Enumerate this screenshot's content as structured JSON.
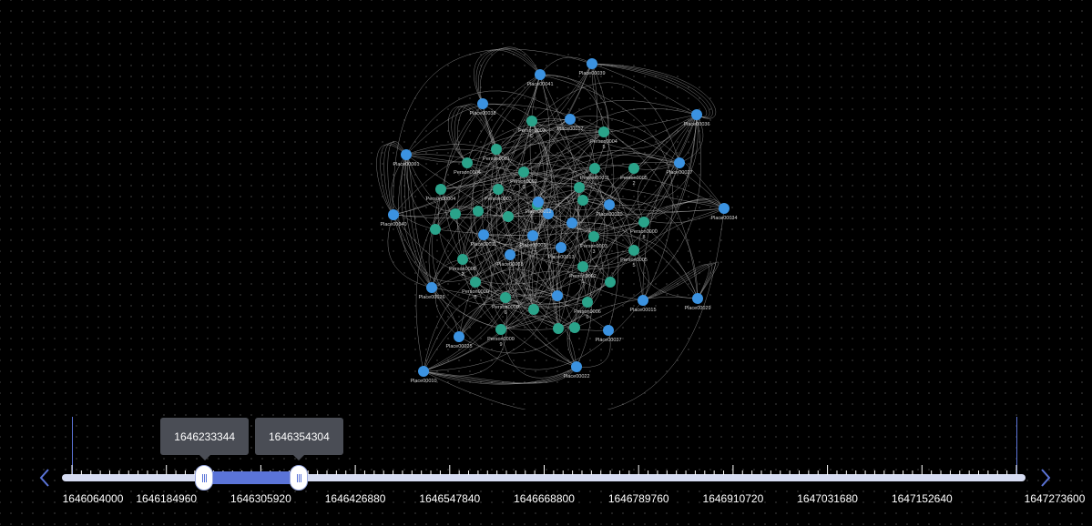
{
  "graph": {
    "colors": {
      "place": "#3b92e0",
      "person": "#2aa38a",
      "edge": "#b8b8b8",
      "label": "#d8d8d8"
    },
    "nodes": [
      {
        "id": "Place00041",
        "label": "Place00041",
        "type": "place"
      },
      {
        "id": "Place00039",
        "label": "Place00039",
        "type": "place"
      },
      {
        "id": "Place00038",
        "label": "Place00038",
        "type": "place"
      },
      {
        "id": "Place00017",
        "label": "Place00017",
        "type": "place"
      },
      {
        "id": "Place00036",
        "label": "Place00036",
        "type": "place"
      },
      {
        "id": "Person00030",
        "label": "Person0003 0",
        "type": "person"
      },
      {
        "id": "Person00045",
        "label": "Person0004 5",
        "type": "person"
      },
      {
        "id": "Place00027",
        "label": "Place00027",
        "type": "place"
      },
      {
        "id": "Person0001",
        "label": "Person0001",
        "type": "person"
      },
      {
        "id": "Place00001",
        "label": "Place00001",
        "type": "place"
      },
      {
        "id": "Person00040",
        "label": "Person0004",
        "type": "person"
      },
      {
        "id": "Person00052",
        "label": "Person0005 2",
        "type": "person"
      },
      {
        "id": "Person00011",
        "label": "Person00011",
        "type": "person"
      },
      {
        "id": "Person00020",
        "label": "Person0002 0",
        "type": "person"
      },
      {
        "id": "Place00034",
        "label": "Place00034",
        "type": "place"
      },
      {
        "id": "Person00031",
        "label": "Person0003",
        "type": "person"
      },
      {
        "id": "Person00004",
        "label": "Person00004",
        "type": "person"
      },
      {
        "id": "Place00040",
        "label": "Place00040",
        "type": "place"
      },
      {
        "id": "Place00012",
        "label": "Place00012",
        "type": "place"
      },
      {
        "id": "Place00020",
        "label": "Place00020",
        "type": "place"
      },
      {
        "id": "Person00008",
        "label": "Person0000 8",
        "type": "person"
      },
      {
        "id": "Person00033",
        "label": "Person0003 3",
        "type": "person"
      },
      {
        "id": "Person00055",
        "label": "Person0005 5",
        "type": "person"
      },
      {
        "id": "Place00011",
        "label": "Place00011",
        "type": "place"
      },
      {
        "id": "Place00003",
        "label": "Place00003",
        "type": "place"
      },
      {
        "id": "Place00013",
        "label": "Place00013",
        "type": "place"
      },
      {
        "id": "Person00002",
        "label": "Person0000 2",
        "type": "person"
      },
      {
        "id": "Person00021",
        "label": "Person0002 1",
        "type": "person"
      },
      {
        "id": "Place00018",
        "label": "Place00018",
        "type": "place"
      },
      {
        "id": "Place00026",
        "label": "Place00026",
        "type": "place"
      },
      {
        "id": "Person00005",
        "label": "Person0000 5",
        "type": "person"
      },
      {
        "id": "Person00006",
        "label": "Person0000 6",
        "type": "person"
      },
      {
        "id": "Place00029",
        "label": "Place00029",
        "type": "place"
      },
      {
        "id": "Place00015",
        "label": "Place00015",
        "type": "place"
      },
      {
        "id": "Person00060",
        "label": "Person0006 0",
        "type": "person"
      },
      {
        "id": "Place00025",
        "label": "Place00025",
        "type": "place"
      },
      {
        "id": "Person00009",
        "label": "Person0000 9",
        "type": "person"
      },
      {
        "id": "Place00037",
        "label": "Place00037",
        "type": "place"
      },
      {
        "id": "Place00022",
        "label": "Place00022",
        "type": "place"
      },
      {
        "id": "Place00010",
        "label": "Place00010",
        "type": "place"
      }
    ]
  },
  "timebar": {
    "start": 1646064000,
    "end": 1647273600,
    "selected_start": 1646233344,
    "selected_end": 1646354304,
    "tick_labels": [
      "1646064000",
      "1646184960",
      "1646305920",
      "1646426880",
      "1646547840",
      "1646668800",
      "1646789760",
      "1646910720",
      "1647031680",
      "1647152640",
      "1647273600"
    ],
    "tooltip_start": "1646233344",
    "tooltip_end": "1646354304",
    "prev_icon": "chevron-left-icon",
    "next_icon": "chevron-right-icon",
    "colors": {
      "track": "#d6dcf2",
      "range": "#5b74d8",
      "tooltip_bg": "#4a4d55"
    }
  }
}
